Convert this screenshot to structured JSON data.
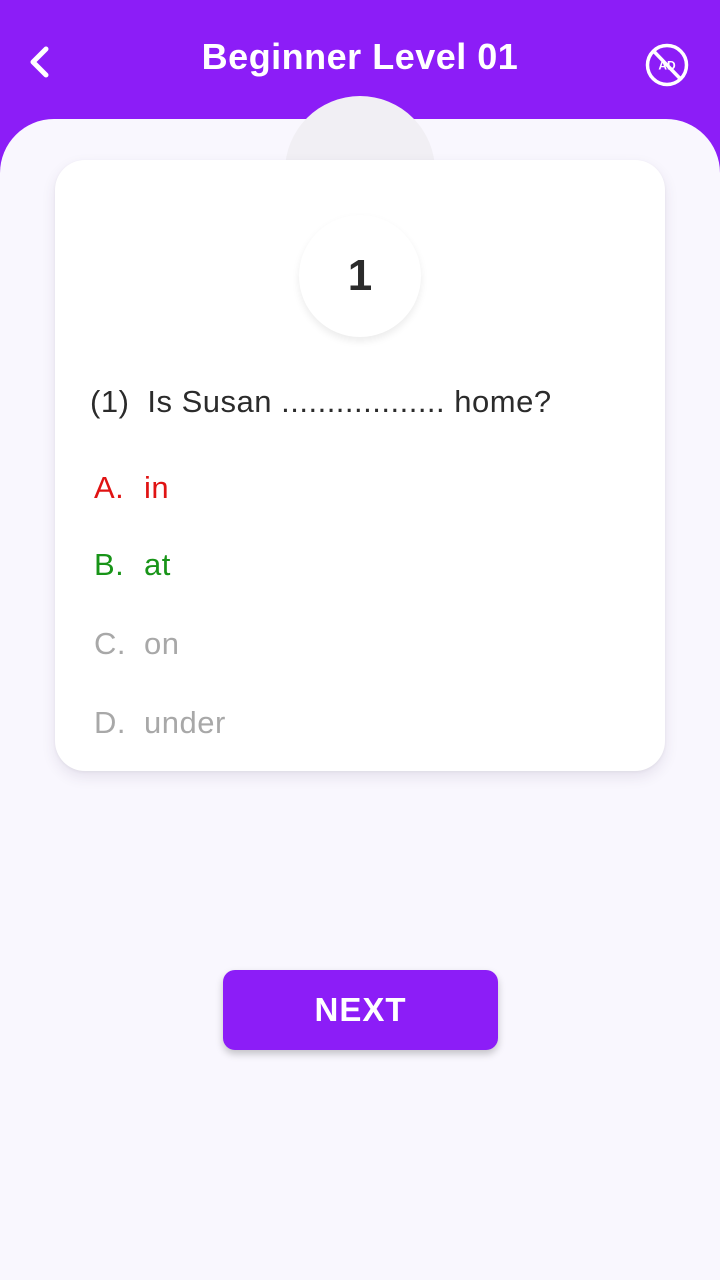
{
  "header": {
    "title": "Beginner Level 01",
    "back_icon": "chevron-left-icon",
    "no_ads_icon": "no-ads-icon",
    "no_ads_text": "AD"
  },
  "quiz": {
    "question_badge": "1",
    "question_number": "(1)",
    "question_text": "Is Susan .................. home?",
    "options": [
      {
        "letter": "A.",
        "text": "in",
        "state": "wrong",
        "color": "#e01313"
      },
      {
        "letter": "B.",
        "text": "at",
        "state": "correct",
        "color": "#189418"
      },
      {
        "letter": "C.",
        "text": "on",
        "state": "neutral",
        "color": "#a8a8a8"
      },
      {
        "letter": "D.",
        "text": "under",
        "state": "neutral",
        "color": "#a8a8a8"
      }
    ]
  },
  "footer": {
    "next_label": "NEXT"
  },
  "colors": {
    "accent": "#8c1df7",
    "background": "#f9f7fe",
    "card": "#ffffff"
  }
}
